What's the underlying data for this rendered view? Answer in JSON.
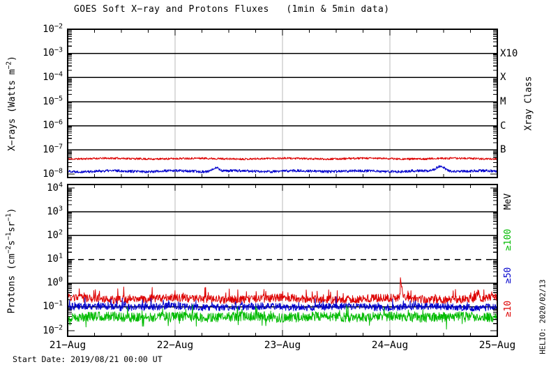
{
  "title": "GOES Soft X−ray and Protons Fluxes   (1min & 5min data)",
  "footer": "Start Date: 2019/08/21 00:00 UT",
  "watermark": "HELIO: 2020/02/13",
  "colors": {
    "red": "#dd0000",
    "blue": "#0000cc",
    "green": "#00bb00",
    "black": "#000000",
    "gray_grid": "#b8b8b8",
    "bg": "#ffffff"
  },
  "x_axis": {
    "tick_labels": [
      "21−Aug",
      "22−Aug",
      "23−Aug",
      "24−Aug",
      "25−Aug"
    ],
    "minor_divisions_per_day": 4,
    "days": 4,
    "start": "2019/08/21 00:00 UT"
  },
  "chart_data": [
    {
      "type": "line",
      "name": "xray-flux-panel",
      "ylabel": "X−rays (Watts m^−2^)",
      "ylim_log": [
        -8,
        -2
      ],
      "y_ticks": [
        "10^−2",
        "10^−3",
        "10^−4",
        "10^−5",
        "10^−6",
        "10^−7",
        "10^−8"
      ],
      "grid": {
        "horizontal_decades": "solid",
        "vertical_days": "gray"
      },
      "right_axis": {
        "title": "Xray Class",
        "labels": [
          {
            "text": "X10",
            "log": -3
          },
          {
            "text": "X",
            "log": -4
          },
          {
            "text": "M",
            "log": -5
          },
          {
            "text": "C",
            "log": -6
          },
          {
            "text": "B",
            "log": -7
          }
        ]
      },
      "series": [
        {
          "name": "xray-long-flux",
          "color_key": "red",
          "approx_level_watts": 4.5e-08,
          "baseline_log": -7.36,
          "noise_dec": 0.04,
          "wobble": {
            "amp": 0.015,
            "freq": 5
          },
          "seed": 11,
          "points": 1300,
          "spike_p": 0,
          "spike_h": 0,
          "bumps": []
        },
        {
          "name": "xray-short-flux",
          "color_key": "blue",
          "approx_level_watts": 1.3e-08,
          "baseline_log": -7.88,
          "noise_dec": 0.055,
          "wobble": {
            "amp": 0.02,
            "freq": 7
          },
          "seed": 22,
          "points": 1300,
          "spike_p": 0,
          "spike_h": 0,
          "bumps": [
            {
              "x": 0.345,
              "h": 0.17,
              "w": 0.007
            },
            {
              "x": 0.868,
              "h": 0.21,
              "w": 0.01
            }
          ]
        }
      ]
    },
    {
      "type": "line",
      "name": "proton-flux-panel",
      "ylabel": "Protons (cm^−2^s^−1^sr^−1^)",
      "ylim_log": [
        -2,
        4
      ],
      "y_ticks": [
        "10^4",
        "10^3",
        "10^2",
        "10^1",
        "10^0",
        "10^−1",
        "10^−2"
      ],
      "dashed_gridline_log": 1,
      "grid": {
        "horizontal_decades": "solid",
        "vertical_days": "gray"
      },
      "right_axis": {
        "title": "MeV",
        "labels": [
          {
            "text": "≥100",
            "color_key": "green"
          },
          {
            "text": "≥50",
            "color_key": "blue"
          },
          {
            "text": "≥10",
            "color_key": "red"
          }
        ]
      },
      "series": [
        {
          "name": "protons-ge-10MeV",
          "color_key": "red",
          "approx_level": 0.22,
          "baseline_log": -0.66,
          "noise_dec": 0.17,
          "wobble": {
            "amp": 0.04,
            "freq": 4
          },
          "seed": 33,
          "points": 1150,
          "spike_p": 0.06,
          "spike_h": 0.4,
          "bumps": [
            {
              "x": 0.776,
              "h": 0.55,
              "w": 0.0022
            },
            {
              "x": 0.955,
              "h": 0.28,
              "w": 0.003
            }
          ]
        },
        {
          "name": "protons-ge-50MeV",
          "color_key": "blue",
          "approx_level": 0.1,
          "baseline_log": -1.0,
          "noise_dec": 0.15,
          "wobble": {
            "amp": 0.03,
            "freq": 5
          },
          "seed": 44,
          "points": 1150,
          "spike_p": 0.05,
          "spike_h": 0.35,
          "bumps": []
        },
        {
          "name": "protons-ge-100MeV",
          "color_key": "green",
          "approx_level": 0.04,
          "baseline_log": -1.42,
          "noise_dec": 0.2,
          "wobble": {
            "amp": 0.03,
            "freq": 6
          },
          "seed": 55,
          "points": 1150,
          "spike_p": 0.06,
          "spike_h": 0.4,
          "spike_both": true,
          "bumps": []
        }
      ]
    }
  ]
}
